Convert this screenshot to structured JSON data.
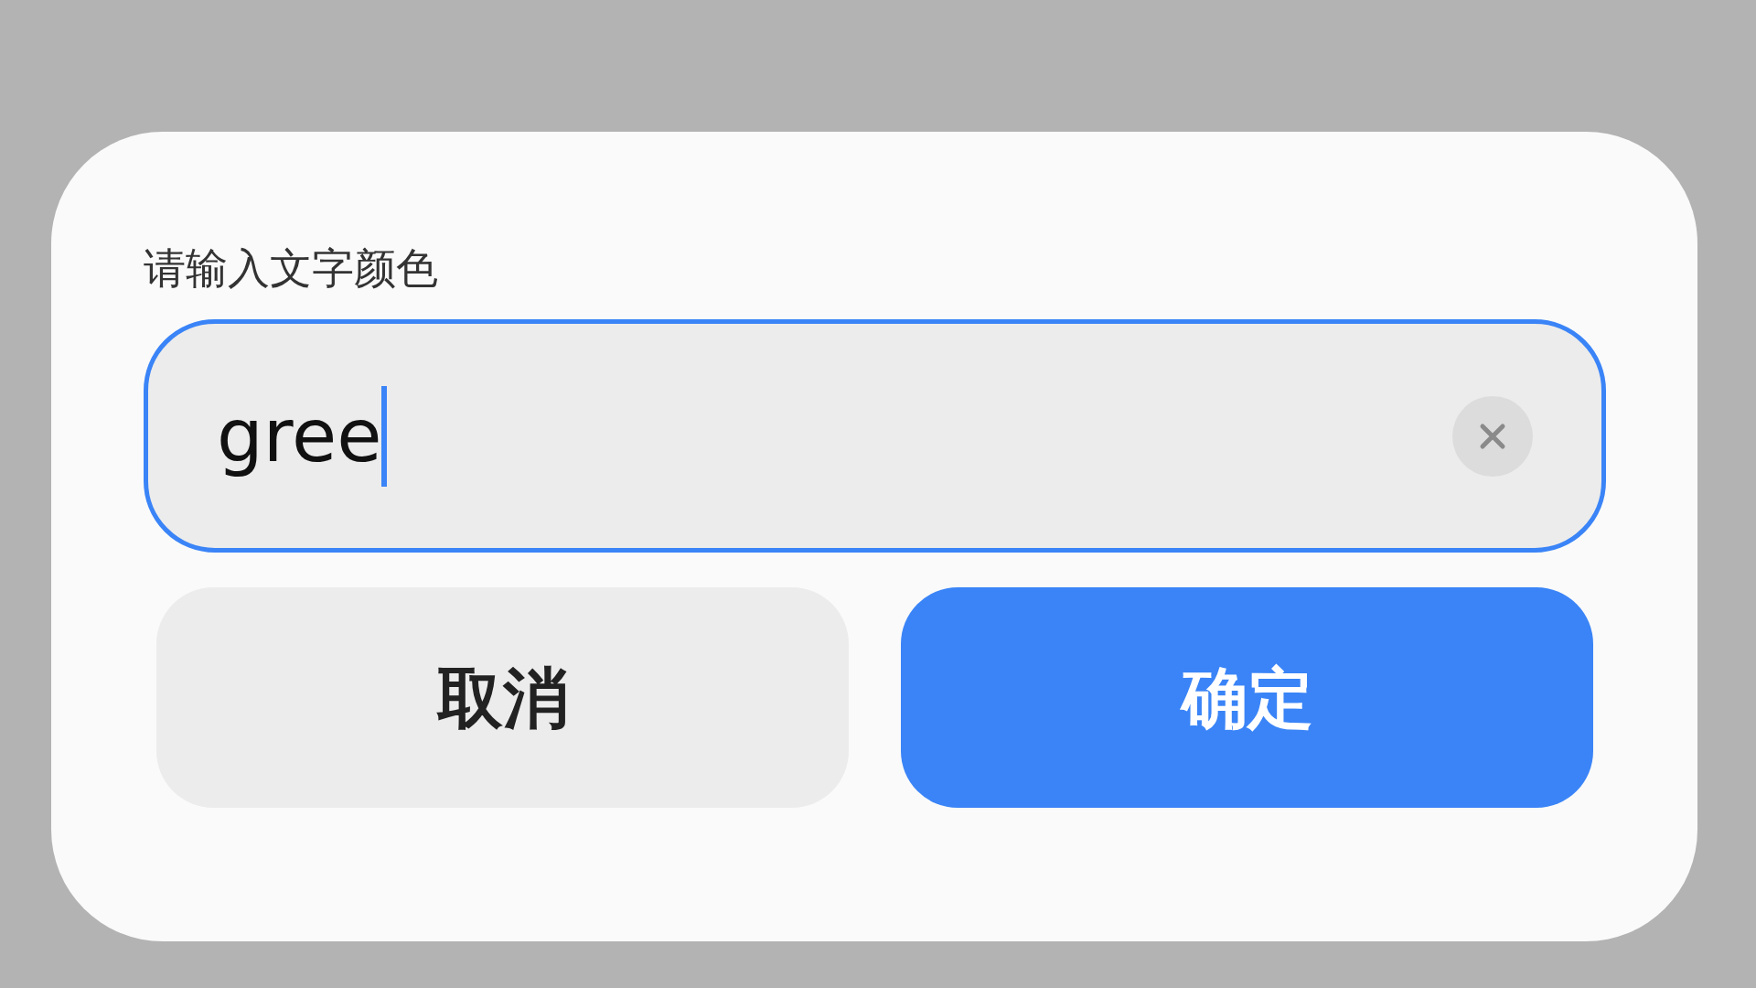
{
  "dialog": {
    "label": "请输入文字颜色",
    "field": {
      "value": "gree",
      "focused": true
    },
    "buttons": [
      {
        "label": "取消",
        "kind": "secondary"
      },
      {
        "label": "确定",
        "kind": "primary"
      }
    ]
  }
}
